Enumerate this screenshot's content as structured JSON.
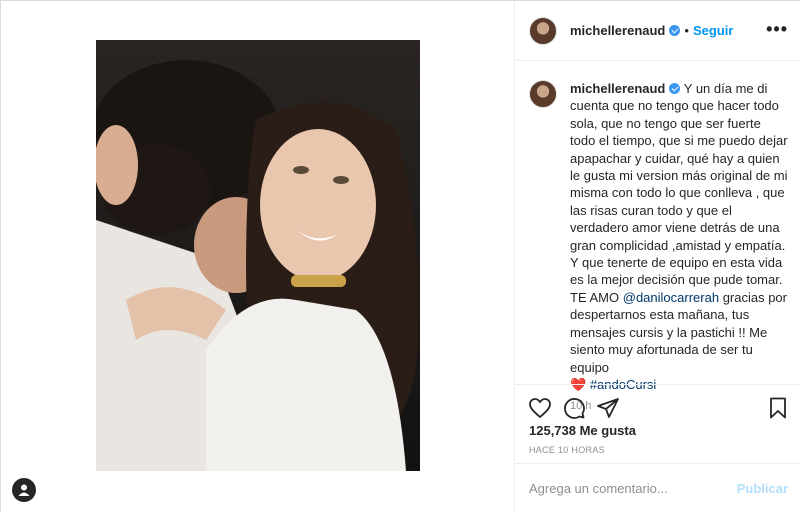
{
  "post": {
    "username": "michellerenaud",
    "follow_label": "Seguir",
    "dot": "•",
    "more_label": "•••",
    "caption": {
      "username": "michellerenaud",
      "text": "Y un día me di cuenta que no tengo que hacer todo sola, que no tengo que ser fuerte todo el tiempo, que si me puedo dejar apapachar y cuidar, qué hay a quien le gusta mi version más original de mi misma con todo lo que conlleva , que las risas curan todo y que el verdadero amor viene detrás de una gran complicidad ,amistad y empatía. Y que tenerte de equipo en esta vida es la mejor decisión que pude tomar.",
      "text2_prefix": "TE AMO",
      "mention": "@danilocarrerah",
      "text2_suffix": "gracias por despertarnos esta mañana, tus mensajes cursis y la pastichi !! Me siento muy afortunada de ser tu equipo",
      "heart": "❤️",
      "hashtag": "#andoCursi"
    },
    "time_ago": "10 h",
    "likes": "125,738 Me gusta",
    "date": "HACE 10 HORAS",
    "comment_placeholder": "Agrega un comentario...",
    "publish_label": "Publicar"
  },
  "icons": {
    "like": "heart-outline-icon",
    "comment": "comment-bubble-icon",
    "share": "paper-plane-icon",
    "save": "bookmark-icon",
    "verified": "verified-badge-icon",
    "profile": "person-icon"
  },
  "colors": {
    "accent": "#0095f6",
    "verified": "#3897f0",
    "muted": "#8e8e8e",
    "link": "#00376b",
    "heart": "#ed4956"
  }
}
